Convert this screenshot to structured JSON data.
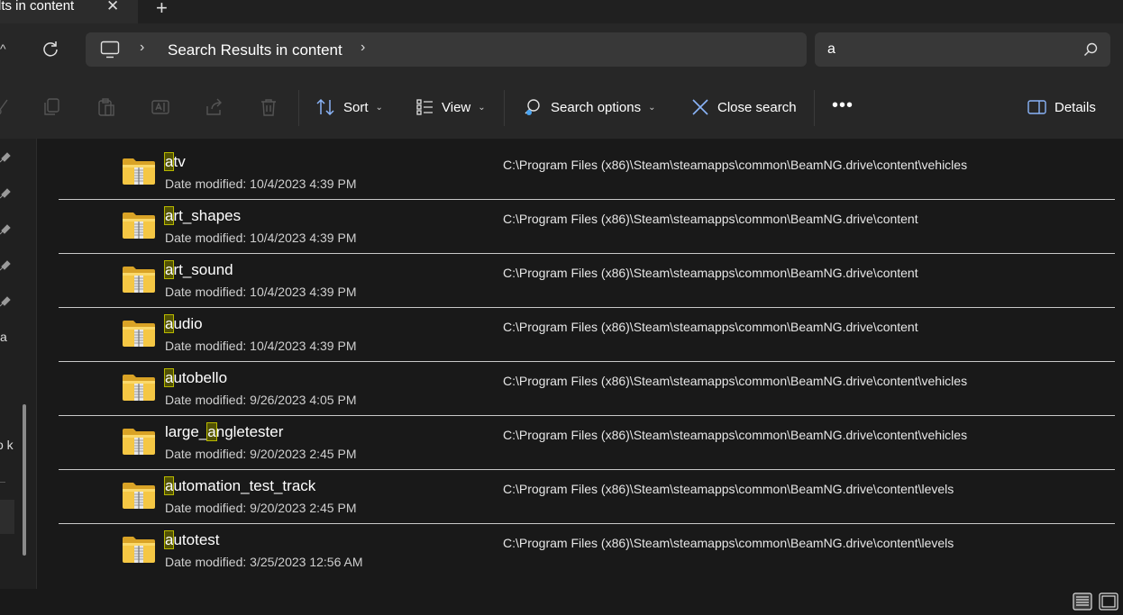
{
  "window": {
    "tab_title": "lts in content",
    "tab_close": "✕",
    "tab_new": "+"
  },
  "address": {
    "up": "^",
    "chevron": "›",
    "breadcrumb": "Search Results in content",
    "chevron_after": "›"
  },
  "search": {
    "value": "a"
  },
  "toolbar": {
    "sort_label": "Sort",
    "view_label": "View",
    "search_options_label": "Search options",
    "close_search_label": "Close search",
    "more_label": "•••",
    "details_label": "Details",
    "caret": "⌄"
  },
  "nav": {
    "fragments": [
      "a",
      "o k"
    ]
  },
  "files": [
    {
      "pre": "",
      "hl": "a",
      "post": "tv",
      "date_prefix": "Date modified:",
      "date": "10/4/2023 4:39 PM",
      "path": "C:\\Program Files (x86)\\Steam\\steamapps\\common\\BeamNG.drive\\content\\vehicles"
    },
    {
      "pre": "",
      "hl": "a",
      "post": "rt_shapes",
      "date_prefix": "Date modified:",
      "date": "10/4/2023 4:39 PM",
      "path": "C:\\Program Files (x86)\\Steam\\steamapps\\common\\BeamNG.drive\\content"
    },
    {
      "pre": "",
      "hl": "a",
      "post": "rt_sound",
      "date_prefix": "Date modified:",
      "date": "10/4/2023 4:39 PM",
      "path": "C:\\Program Files (x86)\\Steam\\steamapps\\common\\BeamNG.drive\\content"
    },
    {
      "pre": "",
      "hl": "a",
      "post": "udio",
      "date_prefix": "Date modified:",
      "date": "10/4/2023 4:39 PM",
      "path": "C:\\Program Files (x86)\\Steam\\steamapps\\common\\BeamNG.drive\\content"
    },
    {
      "pre": "",
      "hl": "a",
      "post": "utobello",
      "date_prefix": "Date modified:",
      "date": "9/26/2023 4:05 PM",
      "path": "C:\\Program Files (x86)\\Steam\\steamapps\\common\\BeamNG.drive\\content\\vehicles"
    },
    {
      "pre": "large_",
      "hl": "a",
      "post": "ngletester",
      "date_prefix": "Date modified:",
      "date": "9/20/2023 2:45 PM",
      "path": "C:\\Program Files (x86)\\Steam\\steamapps\\common\\BeamNG.drive\\content\\vehicles"
    },
    {
      "pre": "",
      "hl": "a",
      "post": "utomation_test_track",
      "date_prefix": "Date modified:",
      "date": "9/20/2023 2:45 PM",
      "path": "C:\\Program Files (x86)\\Steam\\steamapps\\common\\BeamNG.drive\\content\\levels"
    },
    {
      "pre": "",
      "hl": "a",
      "post": "utotest",
      "date_prefix": "Date modified:",
      "date": "3/25/2023 12:56 AM",
      "path": "C:\\Program Files (x86)\\Steam\\steamapps\\common\\BeamNG.drive\\content\\levels"
    }
  ],
  "icons": {
    "folder": "zipped-folder-icon",
    "highlight_color": "#525204"
  }
}
